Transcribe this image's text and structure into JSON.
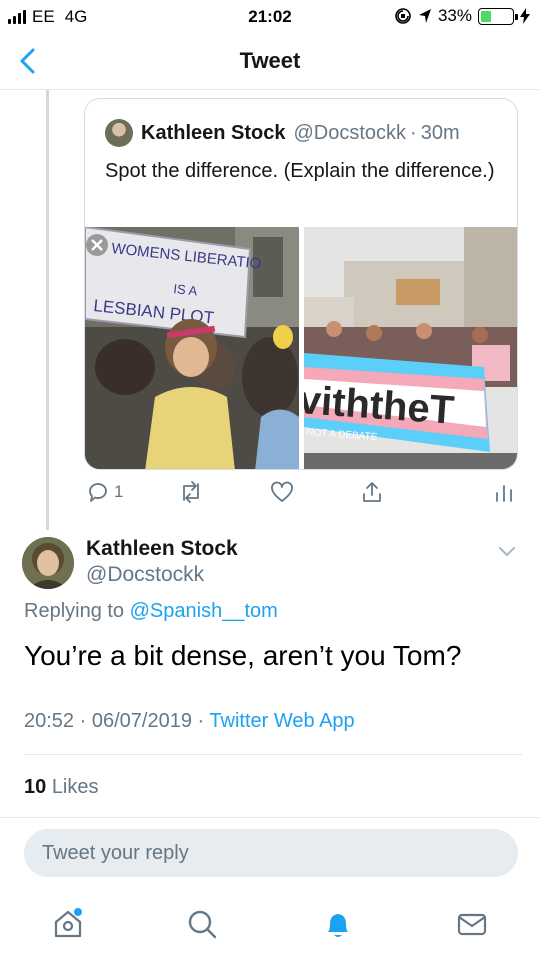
{
  "status_bar": {
    "carrier": "EE",
    "network": "4G",
    "time": "21:02",
    "battery_percent": "33%",
    "battery_level": 0.33
  },
  "nav": {
    "title": "Tweet",
    "back_icon": "chevron-left-icon"
  },
  "quoted_tweet": {
    "author_name": "Kathleen Stock",
    "author_handle": "@Docstockk",
    "separator": "·",
    "age": "30m",
    "text": "Spot the difference. (Explain the difference.)",
    "images": {
      "left_banner_line1": "WOMENS LIBERATIO",
      "left_banner_line2": "IS A",
      "left_banner_line3": "LESBIAN PLOT",
      "right_banner_text": "viththeT",
      "right_banner_subtext": "NOT A DEBATE"
    }
  },
  "actions": {
    "reply_count": "1",
    "icons": [
      "reply-icon",
      "retweet-icon",
      "like-icon",
      "share-icon",
      "analytics-icon"
    ]
  },
  "main_tweet": {
    "author_name": "Kathleen Stock",
    "author_handle": "@Docstockk",
    "replying_prefix": "Replying to",
    "replying_to": "@Spanish__tom",
    "text": "You’re a bit dense, aren’t you Tom?",
    "time": "20:52",
    "date": "06/07/2019",
    "dot": "·",
    "source": "Twitter Web App",
    "likes_count": "10",
    "likes_label": "Likes"
  },
  "reply": {
    "placeholder": "Tweet your reply"
  },
  "tabbar": {
    "items": [
      "home-icon",
      "search-icon",
      "notifications-icon",
      "messages-icon"
    ]
  },
  "colors": {
    "accent": "#1da1f2",
    "secondary_text": "#657786",
    "battery_fill": "#4cd964"
  }
}
